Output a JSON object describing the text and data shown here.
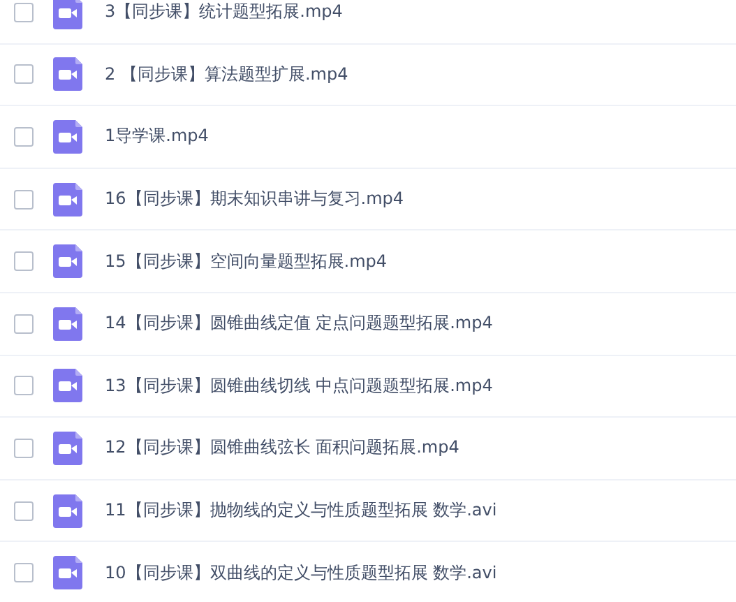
{
  "files": [
    {
      "name": "3【同步课】统计题型拓展.mp4",
      "checked": false
    },
    {
      "name": "2 【同步课】算法题型扩展.mp4",
      "checked": false
    },
    {
      "name": "1导学课.mp4",
      "checked": false
    },
    {
      "name": "16【同步课】期末知识串讲与复习.mp4",
      "checked": false
    },
    {
      "name": "15【同步课】空间向量题型拓展.mp4",
      "checked": false
    },
    {
      "name": "14【同步课】圆锥曲线定值 定点问题题型拓展.mp4",
      "checked": false
    },
    {
      "name": "13【同步课】圆锥曲线切线 中点问题题型拓展.mp4",
      "checked": false
    },
    {
      "name": "12【同步课】圆锥曲线弦长 面积问题拓展.mp4",
      "checked": false
    },
    {
      "name": "11【同步课】抛物线的定义与性质题型拓展 数学.avi",
      "checked": false
    },
    {
      "name": "10【同步课】双曲线的定义与性质题型拓展 数学.avi",
      "checked": false
    }
  ]
}
